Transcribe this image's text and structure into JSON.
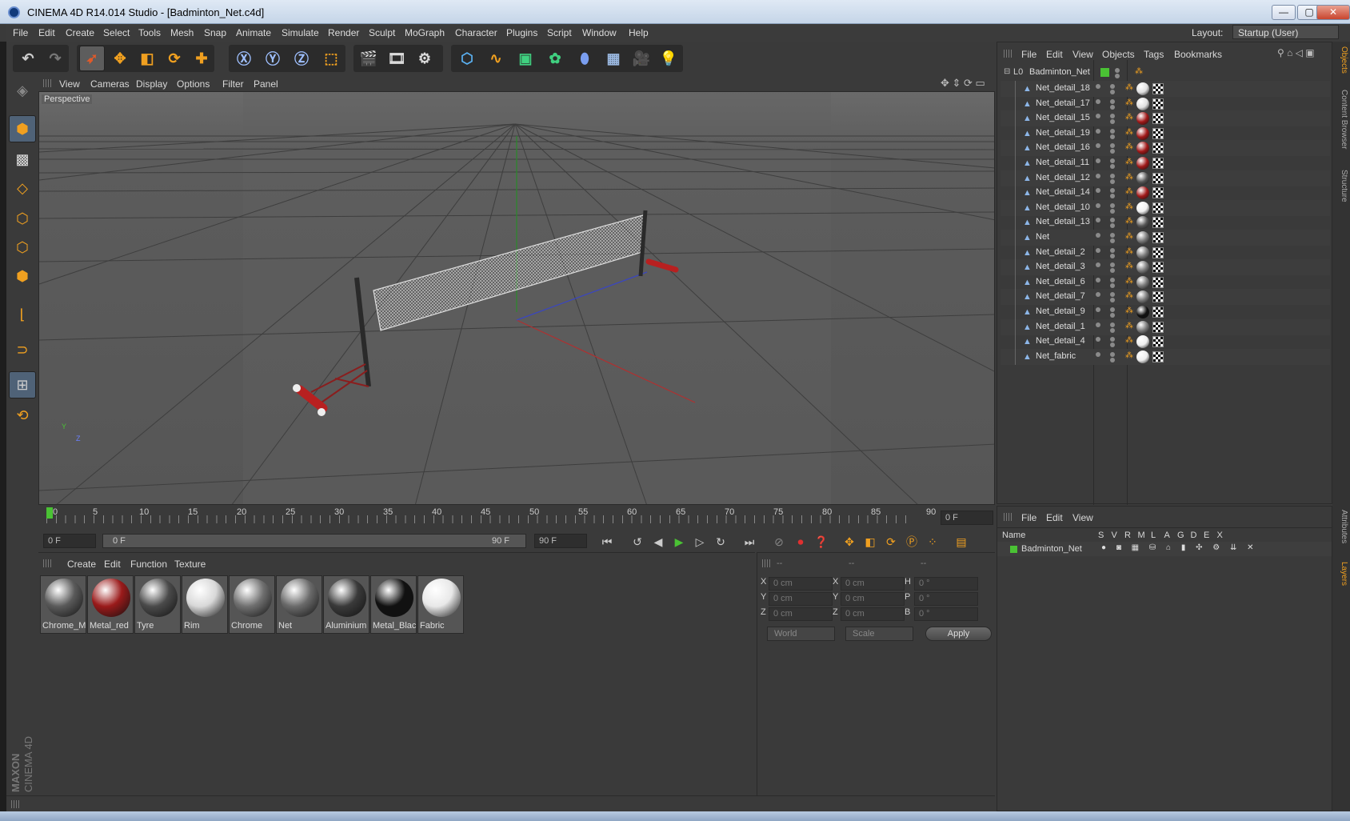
{
  "window": {
    "title": "CINEMA 4D R14.014 Studio - [Badminton_Net.c4d]",
    "min": "—",
    "max": "▢",
    "close": "✕"
  },
  "menu": {
    "items": [
      "File",
      "Edit",
      "Create",
      "Select",
      "Tools",
      "Mesh",
      "Snap",
      "Animate",
      "Simulate",
      "Render",
      "Sculpt",
      "MoGraph",
      "Character",
      "Plugins",
      "Script",
      "Window",
      "Help"
    ],
    "layout_label": "Layout:",
    "layout_value": "Startup (User)"
  },
  "viewport": {
    "menu": [
      "View",
      "Cameras",
      "Display",
      "Options",
      "Filter",
      "Panel"
    ],
    "label": "Perspective",
    "axis_y": "Y",
    "axis_z": "Z"
  },
  "timeline": {
    "ticks": [
      "0",
      "5",
      "10",
      "15",
      "20",
      "25",
      "30",
      "35",
      "40",
      "45",
      "50",
      "55",
      "60",
      "65",
      "70",
      "75",
      "80",
      "85",
      "90"
    ],
    "current_frame": "0 F"
  },
  "playbar": {
    "start": "0 F",
    "range_start": "0 F",
    "range_end": "90 F",
    "end": "90 F"
  },
  "materials": {
    "menu": [
      "Create",
      "Edit",
      "Function",
      "Texture"
    ],
    "items": [
      {
        "name": "Chrome_M",
        "color": "#5a5a5a"
      },
      {
        "name": "Metal_red",
        "color": "#9a1a1a"
      },
      {
        "name": "Tyre",
        "color": "#4a4a4a"
      },
      {
        "name": "Rim",
        "color": "#d8d8d8"
      },
      {
        "name": "Chrome",
        "color": "#707070"
      },
      {
        "name": "Net",
        "color": "#6a6a6a"
      },
      {
        "name": "Aluminium",
        "color": "#3a3a3a"
      },
      {
        "name": "Metal_Blac",
        "color": "#111111"
      },
      {
        "name": "Fabric",
        "color": "#e8e8e8"
      }
    ]
  },
  "coords": {
    "headers": [
      "--",
      "--",
      "--"
    ],
    "rows": [
      {
        "a": "X",
        "av": "0 cm",
        "b": "X",
        "bv": "0 cm",
        "c": "H",
        "cv": "0 °"
      },
      {
        "a": "Y",
        "av": "0 cm",
        "b": "Y",
        "bv": "0 cm",
        "c": "P",
        "cv": "0 °"
      },
      {
        "a": "Z",
        "av": "0 cm",
        "b": "Z",
        "bv": "0 cm",
        "c": "B",
        "cv": "0 °"
      }
    ],
    "mode1": "World",
    "mode2": "Scale",
    "apply": "Apply"
  },
  "objects": {
    "menu": [
      "File",
      "Edit",
      "View",
      "Objects",
      "Tags",
      "Bookmarks"
    ],
    "root": "Badminton_Net",
    "children": [
      {
        "name": "Net_detail_18",
        "mat": "#e0e0e0"
      },
      {
        "name": "Net_detail_17",
        "mat": "#e0e0e0"
      },
      {
        "name": "Net_detail_15",
        "mat": "#a01818"
      },
      {
        "name": "Net_detail_19",
        "mat": "#a01818"
      },
      {
        "name": "Net_detail_16",
        "mat": "#a01818"
      },
      {
        "name": "Net_detail_11",
        "mat": "#a01818"
      },
      {
        "name": "Net_detail_12",
        "mat": "#555555"
      },
      {
        "name": "Net_detail_14",
        "mat": "#a01818"
      },
      {
        "name": "Net_detail_10",
        "mat": "#f0f0f0"
      },
      {
        "name": "Net_detail_13",
        "mat": "#555555"
      },
      {
        "name": "Net",
        "mat": "#777777"
      },
      {
        "name": "Net_detail_2",
        "mat": "#777777"
      },
      {
        "name": "Net_detail_3",
        "mat": "#777777"
      },
      {
        "name": "Net_detail_6",
        "mat": "#777777"
      },
      {
        "name": "Net_detail_7",
        "mat": "#777777"
      },
      {
        "name": "Net_detail_9",
        "mat": "#111111"
      },
      {
        "name": "Net_detail_1",
        "mat": "#777777"
      },
      {
        "name": "Net_detail_4",
        "mat": "#eeeeee"
      },
      {
        "name": "Net_fabric",
        "mat": "#eeeeee"
      }
    ]
  },
  "layers": {
    "menu": [
      "File",
      "Edit",
      "View"
    ],
    "col_name": "Name",
    "cols": [
      "S",
      "V",
      "R",
      "M",
      "L",
      "A",
      "G",
      "D",
      "E",
      "X"
    ],
    "row": "Badminton_Net"
  },
  "right_tabs": [
    "Objects",
    "Content Browser",
    "Structure",
    "Attributes",
    "Layers"
  ],
  "brand": {
    "a": "MAXON",
    "b": "CINEMA 4D"
  },
  "colors": {
    "accent": "#4f6277",
    "selection_green": "#4ac234",
    "axis_x": "#c03030",
    "axis_y": "#30a030",
    "axis_z": "#3040c0"
  }
}
